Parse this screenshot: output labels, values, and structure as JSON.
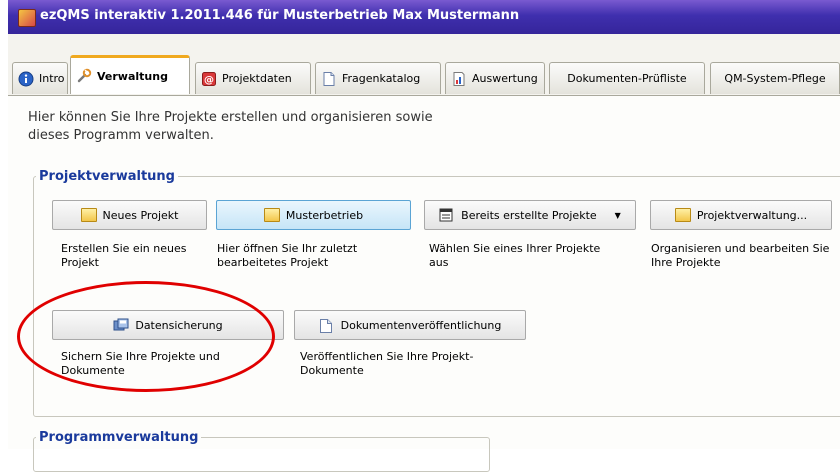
{
  "window": {
    "title": "ezQMS interaktiv 1.2011.446 für Musterbetrieb Max Mustermann",
    "icon": "app-icon"
  },
  "tabs": [
    {
      "label": "Intro",
      "icon": "info-icon"
    },
    {
      "label": "Verwaltung",
      "icon": "tools-icon",
      "active": true
    },
    {
      "label": "Projektdaten",
      "icon": "projektdaten-icon"
    },
    {
      "label": "Fragenkatalog",
      "icon": "document-icon"
    },
    {
      "label": "Auswertung",
      "icon": "report-icon"
    },
    {
      "label": "Dokumenten-Prüfliste"
    },
    {
      "label": "QM-System-Pflege"
    }
  ],
  "intro": {
    "text": "Hier können Sie Ihre Projekte erstellen und organisieren sowie dieses Programm verwalten."
  },
  "projektverwaltung": {
    "legend": "Projektverwaltung",
    "buttons": {
      "neues_projekt": {
        "label": "Neues Projekt",
        "desc": "Erstellen Sie ein neues Projekt"
      },
      "musterbetrieb": {
        "label": "Musterbetrieb",
        "desc": "Hier öffnen Sie Ihr zuletzt bearbeitetes Projekt"
      },
      "bereits": {
        "label": "Bereits erstellte Projekte",
        "desc": "Wählen Sie eines Ihrer Projekte aus"
      },
      "projektverwaltung": {
        "label": "Projektverwaltung...",
        "desc": "Organisieren und bearbeiten Sie Ihre Projekte"
      },
      "datensicherung": {
        "label": "Datensicherung",
        "desc": "Sichern Sie Ihre Projekte und Dokumente"
      },
      "dokveroeff": {
        "label": "Dokumentenveröffentlichung",
        "desc": "Veröffentlichen Sie Ihre Projekt-Dokumente"
      }
    }
  },
  "programmverwaltung": {
    "legend": "Programmverwaltung"
  },
  "colors": {
    "highlight_ellipse": "#e00000",
    "title_bar": "#3f2fae",
    "legend_text": "#1a3a9c",
    "active_tab_accent": "#f0a91f"
  }
}
